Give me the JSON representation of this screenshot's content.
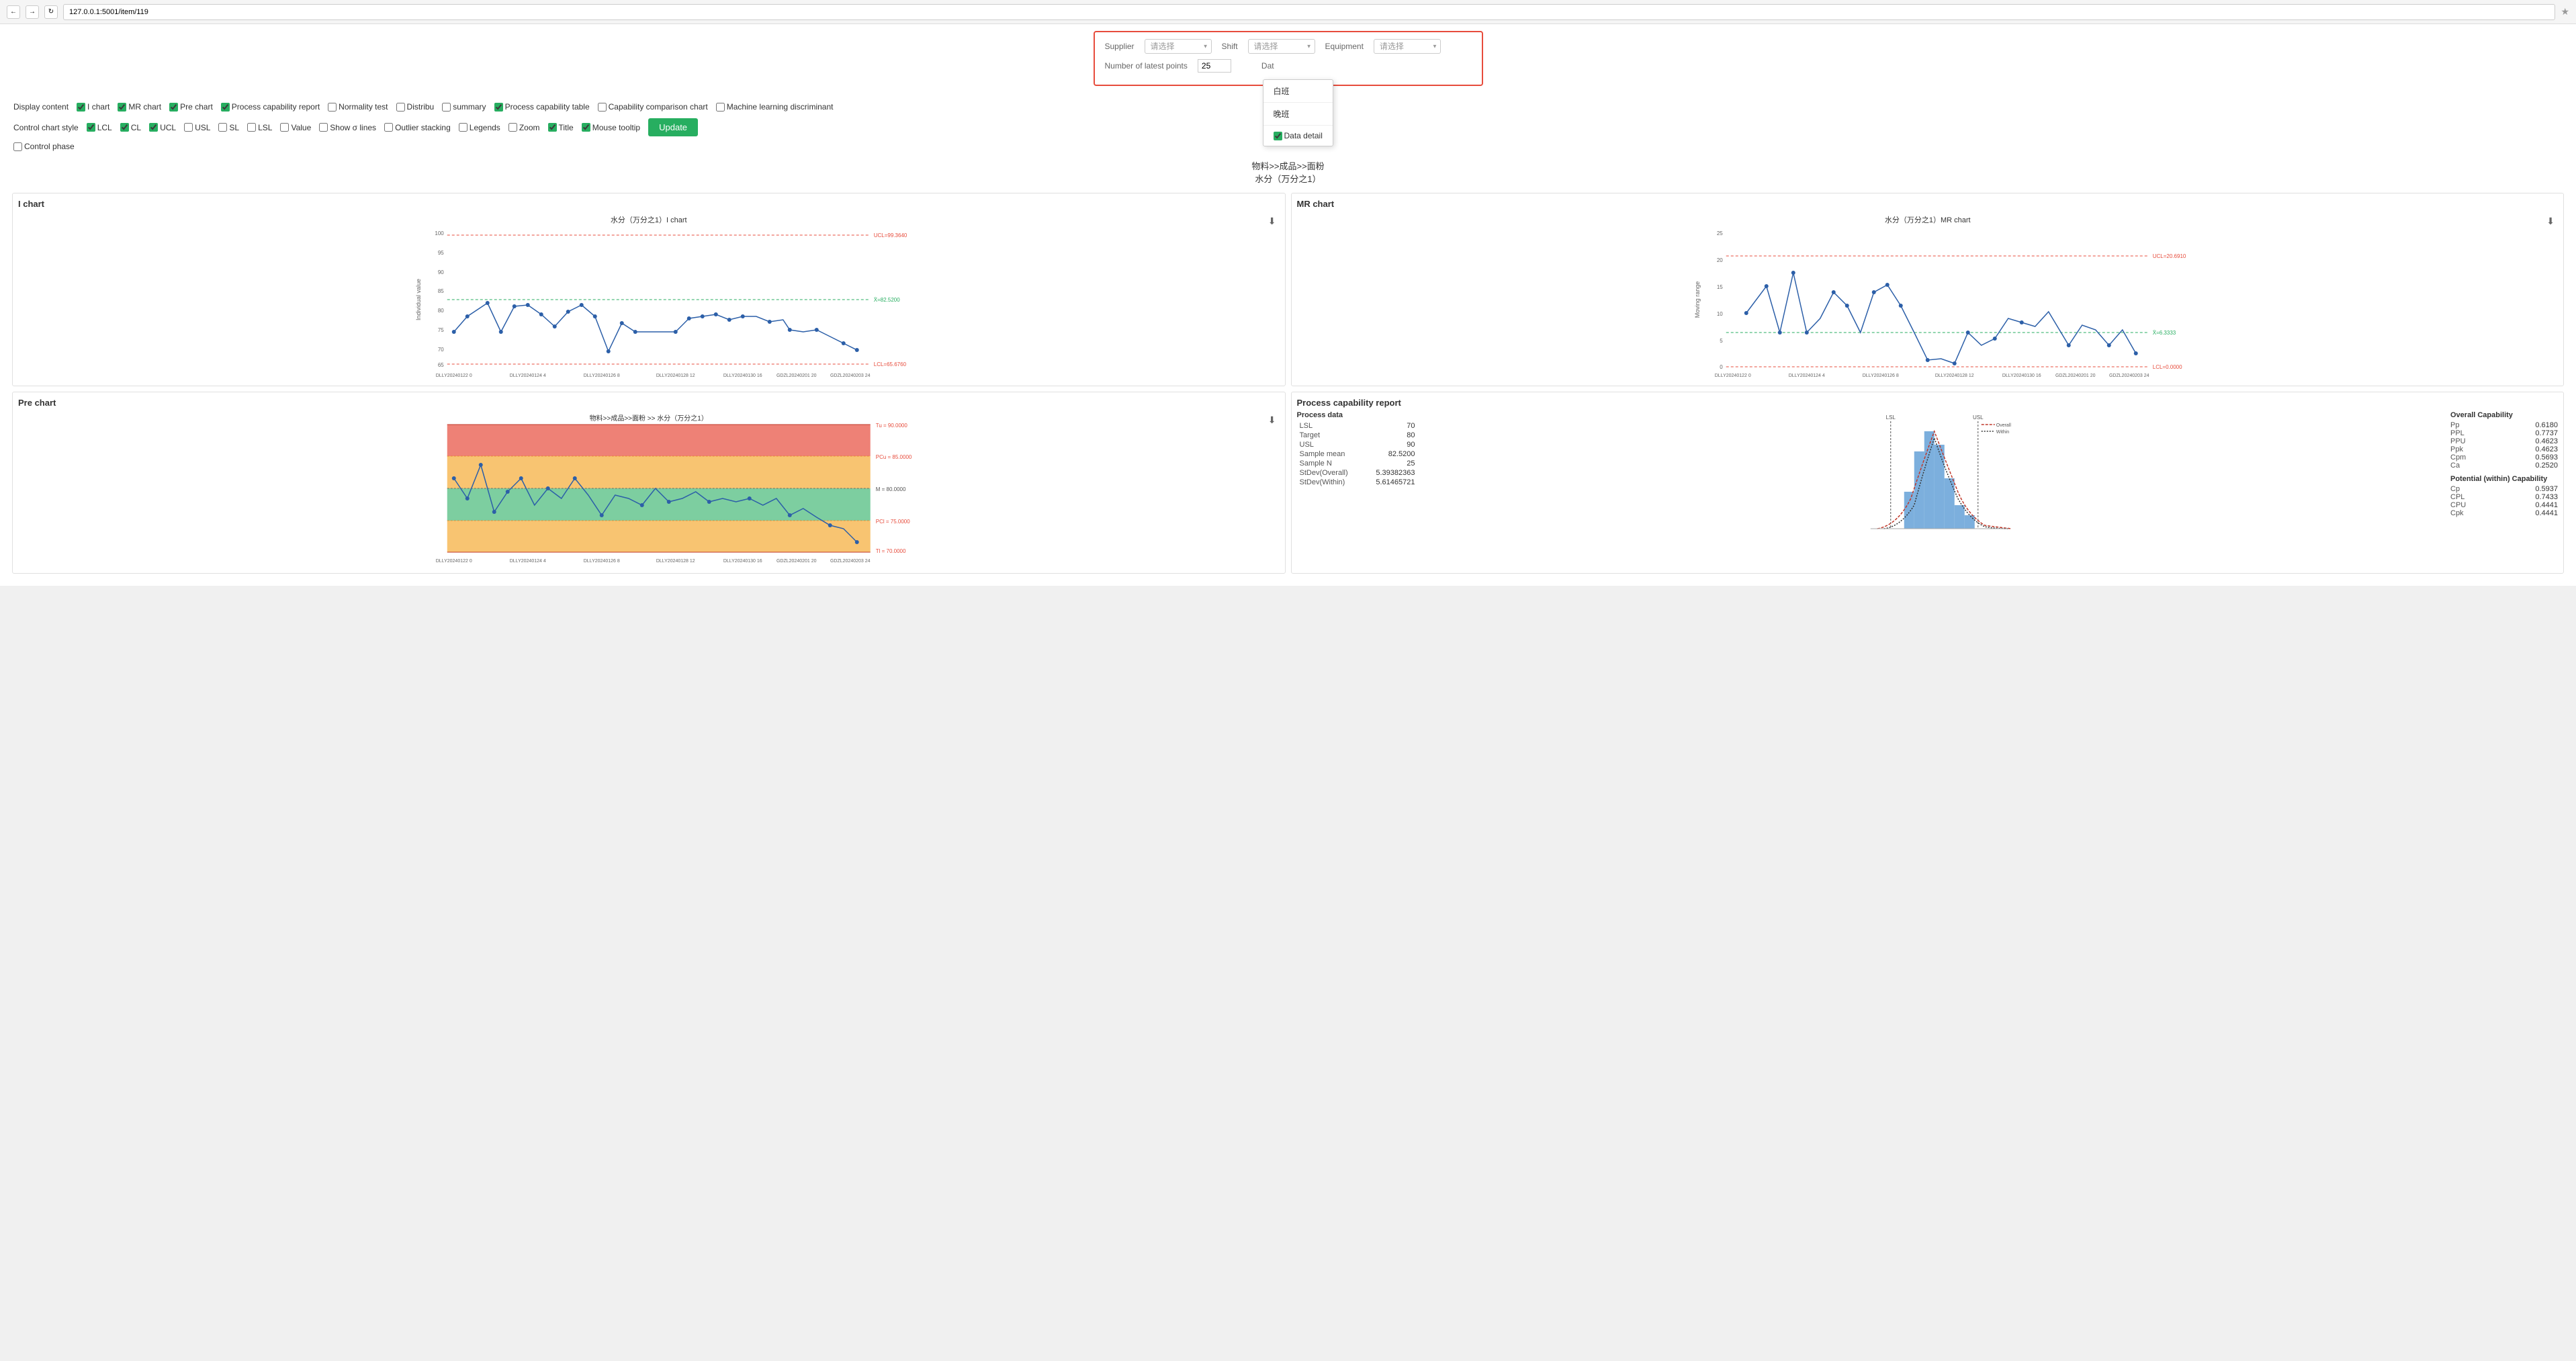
{
  "browser": {
    "url": "127.0.0.1:5001/item/119"
  },
  "filters": {
    "supplier_label": "Supplier",
    "supplier_placeholder": "请选择",
    "shift_label": "Shift",
    "shift_placeholder": "请选择",
    "equipment_label": "Equipment",
    "equipment_placeholder": "请选择",
    "date_label": "Dat",
    "latest_points_label": "Number of latest points",
    "latest_points_value": "25",
    "dropdown_items": [
      "白班",
      "晚班"
    ],
    "data_detail_label": "Data detail"
  },
  "display_content": {
    "label": "Display content",
    "items": [
      {
        "id": "i_chart",
        "label": "I chart",
        "checked": true,
        "green": true
      },
      {
        "id": "mr_chart",
        "label": "MR chart",
        "checked": true,
        "green": true
      },
      {
        "id": "pre_chart",
        "label": "Pre chart",
        "checked": true,
        "green": true
      },
      {
        "id": "process_cap",
        "label": "Process capability report",
        "checked": true,
        "green": true
      },
      {
        "id": "normality",
        "label": "Normality test",
        "checked": false,
        "green": false
      },
      {
        "id": "distrib",
        "label": "Distribu",
        "checked": false,
        "green": false
      },
      {
        "id": "summary",
        "label": "summary",
        "checked": false,
        "green": false
      },
      {
        "id": "cap_table",
        "label": "Process capability table",
        "checked": true,
        "green": true
      },
      {
        "id": "cap_compare",
        "label": "Capability comparison chart",
        "checked": false,
        "green": false
      },
      {
        "id": "ml_disc",
        "label": "Machine learning discriminant",
        "checked": false,
        "green": false
      }
    ]
  },
  "control_chart_style": {
    "label": "Control chart style",
    "items": [
      {
        "id": "lcl",
        "label": "LCL",
        "checked": true,
        "green": true
      },
      {
        "id": "cl",
        "label": "CL",
        "checked": true,
        "green": true
      },
      {
        "id": "ucl",
        "label": "UCL",
        "checked": true,
        "green": true
      },
      {
        "id": "usl",
        "label": "USL",
        "checked": false
      },
      {
        "id": "sl",
        "label": "SL",
        "checked": false
      },
      {
        "id": "lsl",
        "label": "LSL",
        "checked": false
      },
      {
        "id": "value",
        "label": "Value",
        "checked": false
      },
      {
        "id": "show_lines",
        "label": "Show σ lines",
        "checked": false
      },
      {
        "id": "outlier",
        "label": "Outlier stacking",
        "checked": false
      },
      {
        "id": "legends",
        "label": "Legends",
        "checked": false
      },
      {
        "id": "zoom",
        "label": "Zoom",
        "checked": false
      },
      {
        "id": "title",
        "label": "Title",
        "checked": true,
        "green": true
      },
      {
        "id": "mouse_tooltip",
        "label": "Mouse tooltip",
        "checked": true,
        "green": true
      },
      {
        "id": "control_phase",
        "label": "Control phase",
        "checked": false
      }
    ],
    "update_btn": "Update"
  },
  "page_title": {
    "line1": "物料>>成品>>面粉",
    "line2": "水分（万分之1）"
  },
  "i_chart": {
    "title": "I chart",
    "chart_title": "水分（万分之1）I chart",
    "ucl": "UCL=99.3640",
    "mean": "X̄=82.5200",
    "lcl": "LCL=65.6760",
    "y_label": "Individual value",
    "x_labels": [
      "DLLY20240122 0",
      "DLLY20240124 4",
      "DLLY20240126 8",
      "DLLY20240128 12",
      "DLLY20240130 16",
      "GDZL20240201 20",
      "GDZL20240203 24"
    ]
  },
  "mr_chart": {
    "title": "MR chart",
    "chart_title": "水分（万分之1）MR chart",
    "ucl": "UCL=20.6910",
    "mean": "X̄=6.3333",
    "lcl": "LCL=0.0000",
    "y_label": "Moving range",
    "x_labels": [
      "DLLY20240122 0",
      "DLLY20240124 4",
      "DLLY20240126 8",
      "DLLY20240128 12",
      "DLLY20240130 16",
      "GDZL20240201 20",
      "GDZL20240203 24"
    ]
  },
  "pre_chart": {
    "title": "Pre chart",
    "chart_title": "物料>>成品>>面粉 >> 水分（万分之1）",
    "tu": "Tu = 90.0000",
    "pcu": "PCu = 85.0000",
    "m": "M = 80.0000",
    "pcl": "PCl = 75.0000",
    "tl": "Tl = 70.0000",
    "x_labels": [
      "DLLY20240122 0",
      "DLLY20240124 4",
      "DLLY20240126 8",
      "DLLY20240128 12",
      "DLLY20240130 16",
      "GDZL20240201 20",
      "GDZL20240203 24"
    ]
  },
  "capability": {
    "title": "Process capability report",
    "process_data_label": "Process data",
    "lsl_label": "LSL",
    "lsl_val": "70",
    "target_label": "Target",
    "target_val": "80",
    "usl_label": "USL",
    "usl_val": "90",
    "sample_mean_label": "Sample mean",
    "sample_mean_val": "82.5200",
    "sample_n_label": "Sample N",
    "sample_n_val": "25",
    "sdev_overall_label": "StDev(Overall)",
    "sdev_overall_val": "5.39382363",
    "sdev_within_label": "StDev(Within)",
    "sdev_within_val": "5.61465721",
    "overall_capability": "Overall Capability",
    "pp_label": "Pp",
    "pp_val": "0.6180",
    "ppl_label": "PPL",
    "ppl_val": "0.7737",
    "ppu_label": "PPU",
    "ppu_val": "0.4623",
    "ppk_label": "Ppk",
    "ppk_val": "0.4623",
    "cpm_label": "Cpm",
    "cpm_val": "0.5693",
    "ca_label": "Ca",
    "ca_val": "0.2520",
    "potential_capability": "Potential (within) Capability",
    "cp_label": "Cp",
    "cp_val": "0.5937",
    "cpl_label": "CPL",
    "cpl_val": "0.7433",
    "cpu_label": "CPU",
    "cpu_val": "0.4441",
    "cpk_label": "Cpk",
    "cpk_val": "0.4441",
    "legend_overall": "Overall",
    "legend_within": "Within"
  }
}
